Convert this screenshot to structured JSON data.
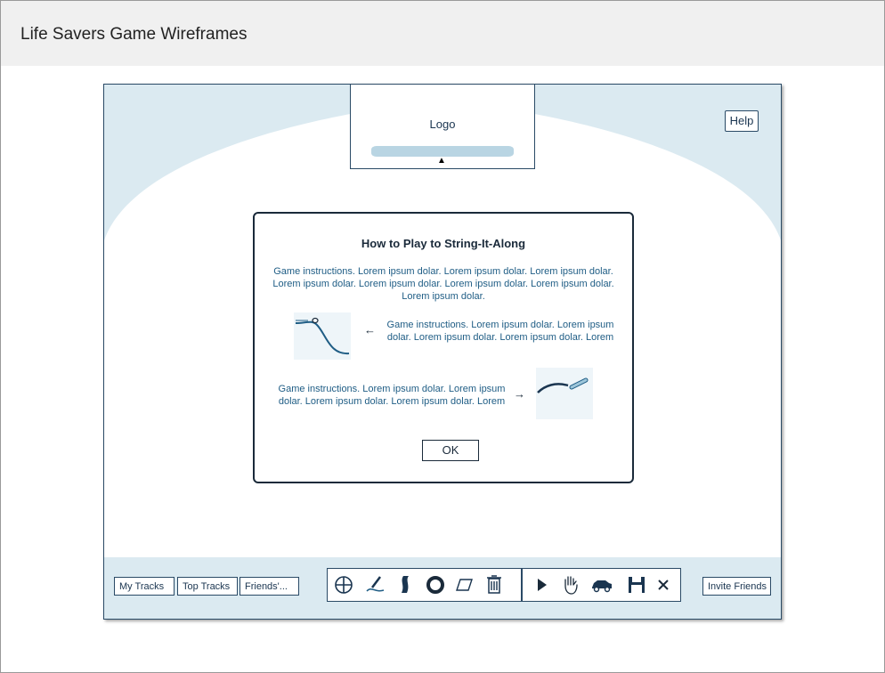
{
  "header": {
    "title": "Life Savers Game Wireframes"
  },
  "logo": {
    "label": "Logo"
  },
  "help": {
    "label": "Help"
  },
  "dialog": {
    "title": "How to Play to String-It-Along",
    "intro": "Game instructions. Lorem ipsum dolar. Lorem ipsum dolar. Lorem ipsum dolar. Lorem ipsum dolar. Lorem ipsum dolar. Lorem ipsum dolar. Lorem ipsum dolar. Lorem ipsum dolar.",
    "step1": "Game instructions. Lorem ipsum dolar. Lorem ipsum dolar. Lorem ipsum dolar. Lorem ipsum dolar. Lorem",
    "step2": "Game instructions. Lorem ipsum dolar. Lorem ipsum dolar. Lorem ipsum dolar. Lorem ipsum dolar. Lorem",
    "ok": "OK"
  },
  "toolbar": {
    "my_tracks": "My Tracks",
    "top_tracks": "Top Tracks",
    "friends": "Friends'...",
    "invite": "Invite Friends",
    "draw_tools": [
      "crosshair-icon",
      "pen-icon",
      "s-curve-icon",
      "ring-icon",
      "eraser-icon",
      "trash-icon"
    ],
    "play_tools": [
      "play-icon",
      "hand-icon",
      "car-icon",
      "save-icon",
      "close-icon"
    ]
  },
  "colors": {
    "canvas": "#dbeaf1",
    "accent": "#1f5d85",
    "dark": "#1a2a3a"
  }
}
